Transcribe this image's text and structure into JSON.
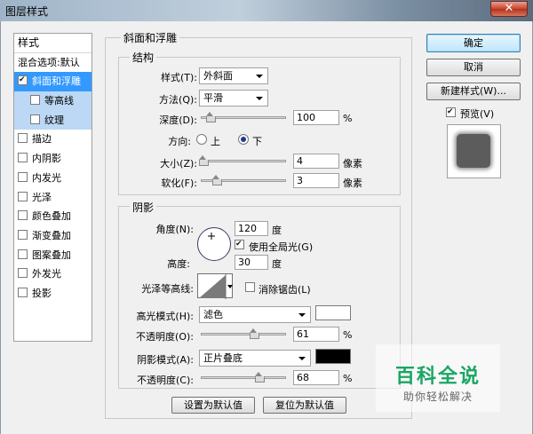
{
  "window": {
    "title": "图层样式",
    "close_glyph": "✕"
  },
  "style_list": {
    "header": "样式",
    "blend_default": "混合选项:默认",
    "items": [
      {
        "label": "斜面和浮雕",
        "checked": true
      },
      {
        "label": "等高线",
        "checked": false
      },
      {
        "label": "纹理",
        "checked": false
      },
      {
        "label": "描边",
        "checked": false
      },
      {
        "label": "内阴影",
        "checked": false
      },
      {
        "label": "内发光",
        "checked": false
      },
      {
        "label": "光泽",
        "checked": false
      },
      {
        "label": "颜色叠加",
        "checked": false
      },
      {
        "label": "渐变叠加",
        "checked": false
      },
      {
        "label": "图案叠加",
        "checked": false
      },
      {
        "label": "外发光",
        "checked": false
      },
      {
        "label": "投影",
        "checked": false
      }
    ]
  },
  "bevel": {
    "group_title": "斜面和浮雕",
    "structure": {
      "title": "结构",
      "style_label": "样式(T):",
      "style_value": "外斜面",
      "technique_label": "方法(Q):",
      "technique_value": "平滑",
      "depth_label": "深度(D):",
      "depth_value": "100",
      "depth_unit": "%",
      "depth_fraction": 0.1,
      "direction_label": "方向:",
      "direction_up": "上",
      "direction_down": "下",
      "direction_selected": "down",
      "size_label": "大小(Z):",
      "size_value": "4",
      "size_unit": "像素",
      "size_fraction": 0.02,
      "soften_label": "软化(F):",
      "soften_value": "3",
      "soften_unit": "像素",
      "soften_fraction": 0.18
    },
    "shading": {
      "title": "阴影",
      "angle_label": "角度(N):",
      "angle_value": "120",
      "angle_unit": "度",
      "global_light_label": "使用全局光(G)",
      "global_light_checked": true,
      "altitude_label": "高度:",
      "altitude_value": "30",
      "altitude_unit": "度",
      "gloss_contour_label": "光泽等高线:",
      "anti_aliased_label": "消除锯齿(L)",
      "anti_aliased_checked": false,
      "highlight_mode_label": "高光模式(H):",
      "highlight_mode_value": "滤色",
      "highlight_color": "#ffffff",
      "highlight_opacity_label": "不透明度(O):",
      "highlight_opacity_value": "61",
      "highlight_opacity_unit": "%",
      "highlight_opacity_fraction": 0.61,
      "shadow_mode_label": "阴影模式(A):",
      "shadow_mode_value": "正片叠底",
      "shadow_color": "#000000",
      "shadow_opacity_label": "不透明度(C):",
      "shadow_opacity_value": "68",
      "shadow_opacity_unit": "%",
      "shadow_opacity_fraction": 0.68
    },
    "make_default": "设置为默认值",
    "reset_default": "复位为默认值"
  },
  "buttons": {
    "ok": "确定",
    "cancel": "取消",
    "new_style": "新建样式(W)...",
    "preview_label": "预览(V)",
    "preview_checked": true
  },
  "watermark": {
    "title": "百科全说",
    "subtitle": "助你轻松解决"
  }
}
